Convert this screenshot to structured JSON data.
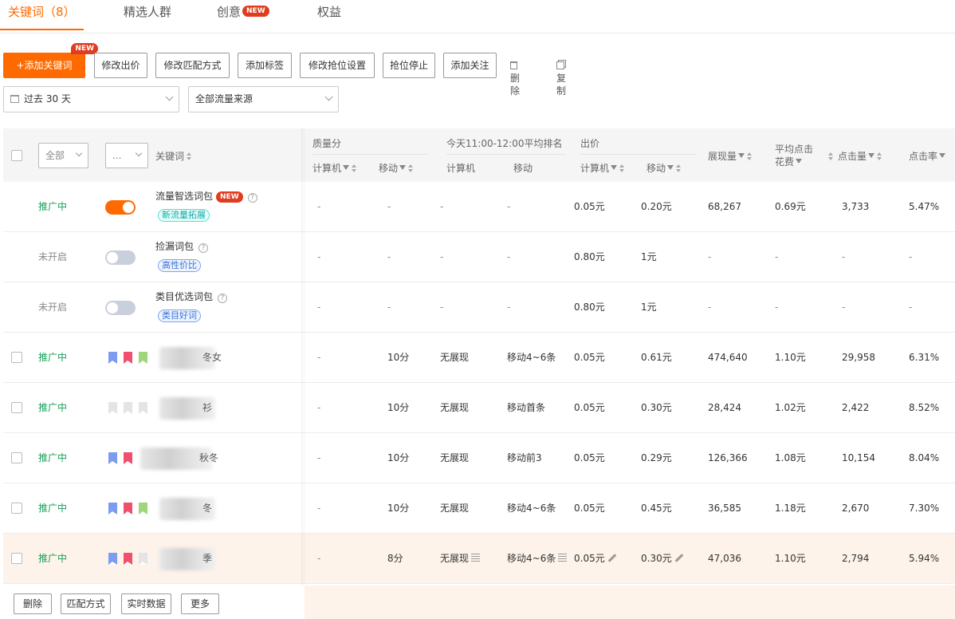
{
  "tabs": [
    {
      "label": "关键词（8）"
    },
    {
      "label": "精选人群"
    },
    {
      "label": "创意",
      "badge": "NEW"
    },
    {
      "label": "权益"
    }
  ],
  "toolbar": {
    "add_keyword": "+添加关键词",
    "add_badge": "NEW",
    "buttons": [
      "修改出价",
      "修改匹配方式",
      "添加标签",
      "修改抢位设置",
      "抢位停止",
      "添加关注"
    ],
    "delete": "删除",
    "copy": "复制"
  },
  "filters": {
    "date_range": "过去 30 天",
    "traffic_source": "全部流量来源"
  },
  "table_head": {
    "status_filter": "全部",
    "more_filter": "...",
    "keyword": "关键词",
    "quality_score": "质量分",
    "avg_rank": "今天11:00-12:00平均排名",
    "bid": "出价",
    "pc": "计算机",
    "mobile": "移动",
    "impressions": "展现量",
    "avg_cpc_line1": "平均点击",
    "avg_cpc_line2": "花费",
    "clicks": "点击量",
    "ctr": "点击率"
  },
  "rows": [
    {
      "status": "推广中",
      "toggle": "on",
      "name": "流量智选词包",
      "badge": "NEW",
      "tag": "新流量拓展",
      "tag_color": "cyan",
      "qs_pc": "-",
      "qs_m": "-",
      "rank_pc": "-",
      "rank_m": "-",
      "bid_pc": "0.05元",
      "bid_m": "0.20元",
      "imp": "68,267",
      "cpc": "0.69元",
      "clicks": "3,733",
      "ctr": "5.47%"
    },
    {
      "status": "未开启",
      "toggle": "off",
      "name": "捡漏词包",
      "tag": "高性价比",
      "tag_color": "blue",
      "qs_pc": "-",
      "qs_m": "-",
      "rank_pc": "-",
      "rank_m": "-",
      "bid_pc": "0.80元",
      "bid_m": "1元",
      "imp": "-",
      "cpc": "-",
      "clicks": "-",
      "ctr": "-"
    },
    {
      "status": "未开启",
      "toggle": "off",
      "name": "类目优选词包",
      "tag": "类目好词",
      "tag_color": "blue",
      "qs_pc": "-",
      "qs_m": "-",
      "rank_pc": "-",
      "rank_m": "-",
      "bid_pc": "0.80元",
      "bid_m": "1元",
      "imp": "-",
      "cpc": "-",
      "clicks": "-",
      "ctr": "-"
    },
    {
      "status": "推广中",
      "kw_suffix": "冬女",
      "flags": [
        "#7d9cf0",
        "#f0506e",
        "#9fd67c"
      ],
      "qs_pc": "-",
      "qs_m": "10分",
      "rank_pc": "无展现",
      "rank_m": "移动4~6条",
      "bid_pc": "0.05元",
      "bid_m": "0.61元",
      "imp": "474,640",
      "cpc": "1.10元",
      "clicks": "29,958",
      "ctr": "6.31%"
    },
    {
      "status": "推广中",
      "kw_suffix": "衫",
      "flags": [
        "#e4e4e4",
        "#e4e4e4",
        "#e4e4e4"
      ],
      "qs_pc": "-",
      "qs_m": "10分",
      "rank_pc": "无展现",
      "rank_m": "移动首条",
      "bid_pc": "0.05元",
      "bid_m": "0.30元",
      "imp": "28,424",
      "cpc": "1.02元",
      "clicks": "2,422",
      "ctr": "8.52%"
    },
    {
      "status": "推广中",
      "kw_suffix": "秋冬",
      "flags": [
        "#7d9cf0",
        "#f0506e"
      ],
      "qs_pc": "-",
      "qs_m": "10分",
      "rank_pc": "无展现",
      "rank_m": "移动前3",
      "bid_pc": "0.05元",
      "bid_m": "0.29元",
      "imp": "126,366",
      "cpc": "1.08元",
      "clicks": "10,154",
      "ctr": "8.04%"
    },
    {
      "status": "推广中",
      "kw_suffix": "冬",
      "flags": [
        "#7d9cf0",
        "#f0506e",
        "#9fd67c"
      ],
      "qs_pc": "-",
      "qs_m": "10分",
      "rank_pc": "无展现",
      "rank_m": "移动4~6条",
      "bid_pc": "0.05元",
      "bid_m": "0.45元",
      "imp": "36,585",
      "cpc": "1.18元",
      "clicks": "2,670",
      "ctr": "7.30%"
    },
    {
      "status": "推广中",
      "kw_suffix": "季",
      "flags": [
        "#7d9cf0",
        "#f0506e",
        "#e4e4e4"
      ],
      "qs_pc": "-",
      "qs_m": "8分",
      "rank_pc": "无展现",
      "rank_m": "移动4~6条",
      "bid_pc": "0.05元",
      "bid_m": "0.30元",
      "imp": "47,036",
      "cpc": "1.10元",
      "clicks": "2,794",
      "ctr": "5.94%",
      "highlight": true
    }
  ],
  "footer": {
    "buttons": [
      "删除",
      "匹配方式",
      "实时数据",
      "更多"
    ]
  },
  "colors": {
    "accent": "#ff6a00",
    "badge": "#e03c1f",
    "status_on": "#18a058"
  }
}
